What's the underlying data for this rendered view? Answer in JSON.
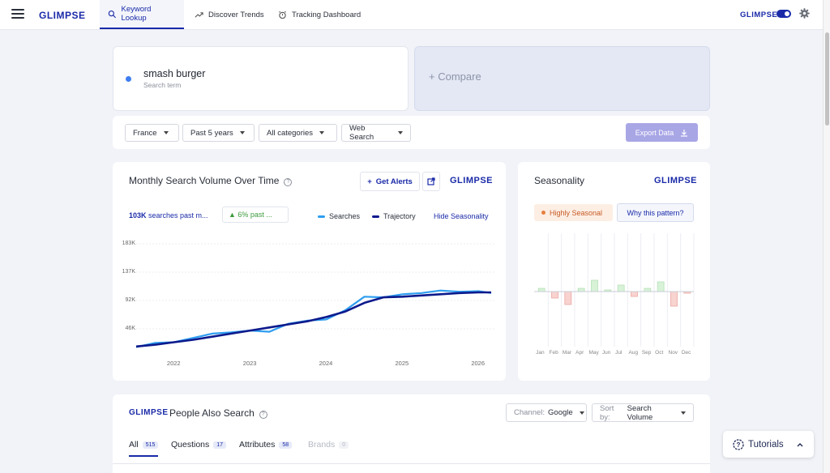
{
  "app": {
    "logo": "GLIMPSE"
  },
  "nav": {
    "tabs": [
      {
        "label": "Keyword Lookup",
        "icon": "search-icon",
        "active": true
      },
      {
        "label": "Discover Trends",
        "icon": "trending-icon",
        "active": false
      },
      {
        "label": "Tracking Dashboard",
        "icon": "alarm-icon",
        "active": false
      }
    ]
  },
  "search": {
    "term": "smash burger",
    "term_sub": "Search term",
    "compare": "Compare"
  },
  "filters": {
    "country": "France",
    "period": "Past 5 years",
    "category": "All categories",
    "source": "Web Search",
    "export": "Export Data"
  },
  "volume_card": {
    "title": "Monthly Search Volume Over Time",
    "get_alerts": "Get Alerts",
    "brand": "GLIMPSE",
    "stat_value": "103K",
    "stat_text": "searches past m...",
    "growth": "▲ 6% past ...",
    "legend_searches": "Searches",
    "legend_trajectory": "Trajectory",
    "hide_seasonality": "Hide Seasonality"
  },
  "seasonality_card": {
    "title": "Seasonality",
    "brand": "GLIMPSE",
    "badge": "Highly Seasonal",
    "why": "Why this pattern?"
  },
  "people_card": {
    "brand": "GLIMPSE",
    "title": "People Also Search",
    "channel_label": "Channel:",
    "channel_value": "Google",
    "sort_label": "Sort by:",
    "sort_value": "Search Volume",
    "tabs": [
      {
        "label": "All",
        "count": "515"
      },
      {
        "label": "Questions",
        "count": "17"
      },
      {
        "label": "Attributes",
        "count": "58"
      },
      {
        "label": "Brands",
        "count": "0"
      }
    ]
  },
  "tutorials": {
    "label": "Tutorials"
  },
  "colors": {
    "brand": "#1a2aa8",
    "searches": "#2f9ef0",
    "trajectory": "#0d1a8c",
    "positive": "#d8f2d8",
    "negative": "#f8d3d0"
  },
  "chart_data": [
    {
      "type": "line",
      "title": "Monthly Search Volume Over Time",
      "ylim": [
        0,
        183000
      ],
      "y_ticks": [
        "183K",
        "137K",
        "92K",
        "46K"
      ],
      "x_ticks": [
        "2022",
        "2023",
        "2024",
        "2025",
        "2026"
      ],
      "x": [
        "2021-07",
        "2021-10",
        "2022-01",
        "2022-04",
        "2022-07",
        "2022-10",
        "2023-01",
        "2023-04",
        "2023-07",
        "2023-10",
        "2024-01",
        "2024-04",
        "2024-07",
        "2024-10",
        "2025-01",
        "2025-04",
        "2025-07",
        "2025-10",
        "2026-01",
        "2026-03"
      ],
      "series": [
        {
          "name": "Searches",
          "values": [
            15000,
            22000,
            23000,
            30000,
            37000,
            39000,
            42000,
            40000,
            53000,
            58000,
            60000,
            75000,
            97000,
            96000,
            101000,
            103000,
            107000,
            105000,
            106000,
            103000
          ]
        },
        {
          "name": "Trajectory",
          "values": [
            16000,
            19000,
            23000,
            27000,
            32000,
            37000,
            42000,
            47000,
            52000,
            57000,
            64000,
            73000,
            87000,
            96000,
            97000,
            99000,
            101000,
            103000,
            104000,
            104000
          ]
        }
      ]
    },
    {
      "type": "bar",
      "title": "Seasonality",
      "categories": [
        "Jan",
        "Feb",
        "Mar",
        "Apr",
        "May",
        "Jun",
        "Jul",
        "Aug",
        "Sep",
        "Oct",
        "Nov",
        "Dec"
      ],
      "values": [
        2,
        -4,
        -8,
        2,
        7,
        1,
        4,
        -3,
        2,
        6,
        -9,
        -1
      ]
    }
  ]
}
